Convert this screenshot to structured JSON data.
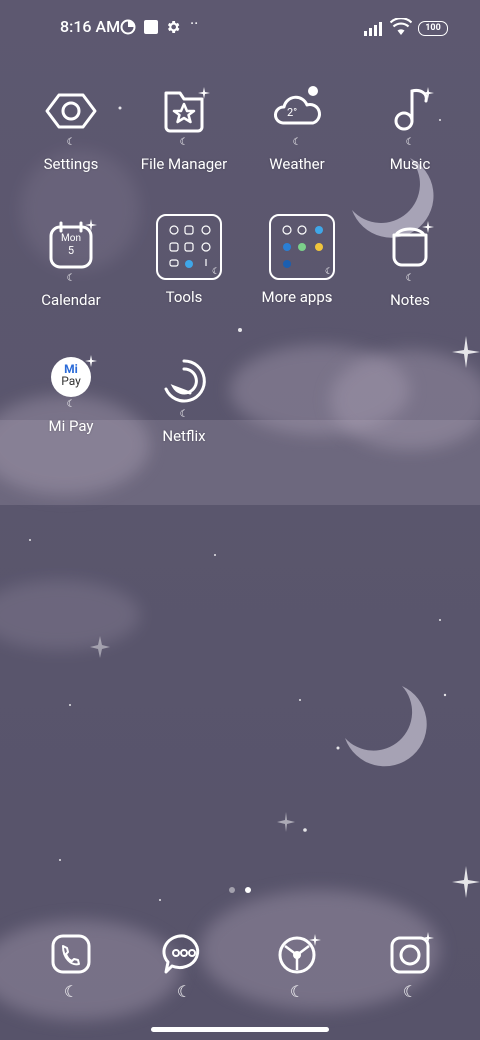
{
  "status_bar": {
    "time": "8:16 AM",
    "battery": "100"
  },
  "apps": [
    {
      "label": "Settings"
    },
    {
      "label": "File Manager"
    },
    {
      "label": "Weather",
      "temp": "2°"
    },
    {
      "label": "Music"
    },
    {
      "label": "Calendar",
      "day_name": "Mon",
      "day_num": "5"
    },
    {
      "label": "Tools"
    },
    {
      "label": "More apps"
    },
    {
      "label": "Notes"
    },
    {
      "label": "Mi Pay",
      "badge_top": "Mi",
      "badge_bottom": "Pay"
    },
    {
      "label": "Netflix"
    }
  ],
  "dock": [
    {
      "name": "phone"
    },
    {
      "name": "messages"
    },
    {
      "name": "browser"
    },
    {
      "name": "camera"
    }
  ],
  "page_indicator": {
    "count": 2,
    "active": 1
  }
}
